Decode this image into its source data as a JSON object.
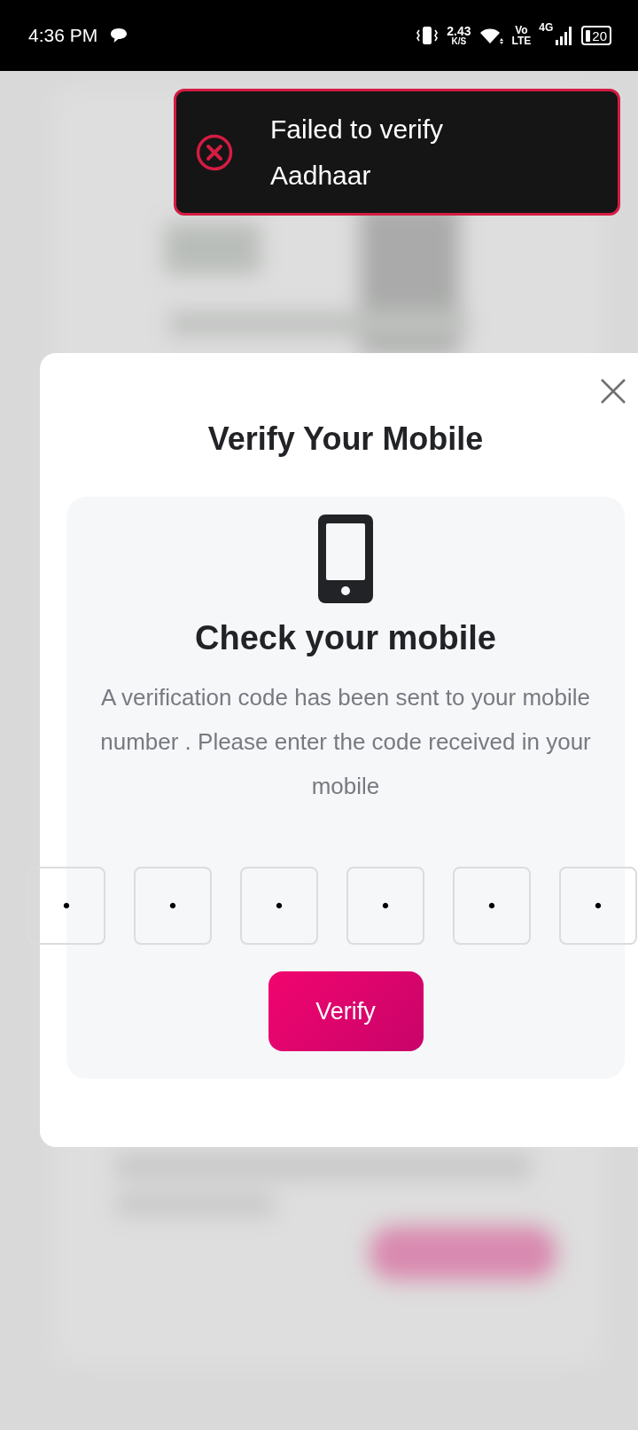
{
  "status_bar": {
    "time": "4:36 PM",
    "speed": "2.43",
    "speed_unit": "K/S",
    "volte_top": "Vo",
    "volte_bottom": "LTE",
    "network": "4G",
    "battery": "20"
  },
  "toast": {
    "kind": "error",
    "message": "Failed to verify Aadhaar"
  },
  "dialog": {
    "title": "Verify Your Mobile",
    "heading": "Check your mobile",
    "description": "A verification code has been sent to your mobile number . Please enter the code received in your mobile",
    "code_digits": [
      "•",
      "•",
      "•",
      "•",
      "•",
      "•"
    ],
    "button": "Verify"
  }
}
